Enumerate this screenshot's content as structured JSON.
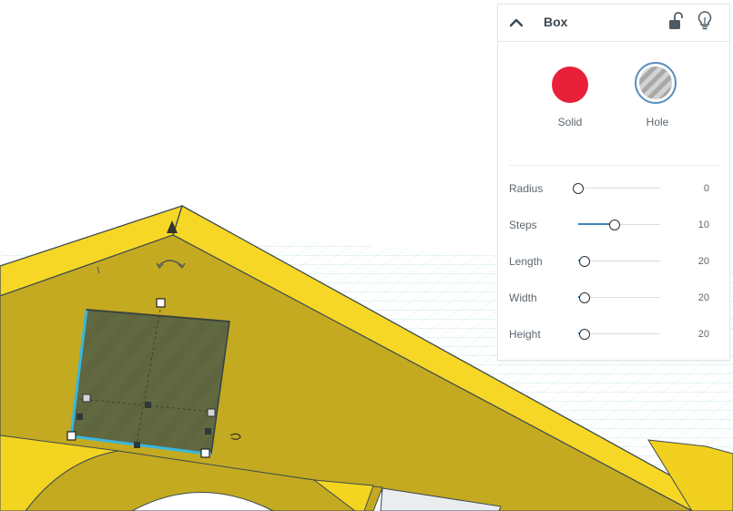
{
  "panel": {
    "title": "Box",
    "types": [
      {
        "label": "Solid",
        "color": "#e8203a"
      },
      {
        "label": "Hole",
        "color": "#a8a8a8"
      }
    ],
    "properties": [
      {
        "label": "Radius",
        "value": "0",
        "fraction": 0.0
      },
      {
        "label": "Steps",
        "value": "10",
        "fraction": 0.44
      },
      {
        "label": "Length",
        "value": "20",
        "fraction": 0.08
      },
      {
        "label": "Width",
        "value": "20",
        "fraction": 0.08
      },
      {
        "label": "Height",
        "value": "20",
        "fraction": 0.08
      }
    ]
  },
  "colors": {
    "shape_yellow": "#f2d11f",
    "shape_shadow": "#c5ad20",
    "hole_selection": "#5a6238",
    "selection_outline": "#34b8e0",
    "grid": "#cde8ef",
    "slider_fill": "#3c84b8"
  },
  "icons": [
    "chevron-up-icon",
    "unlock-icon",
    "lightbulb-icon",
    "rotate-arrow-icon",
    "lift-arrow-icon"
  ]
}
